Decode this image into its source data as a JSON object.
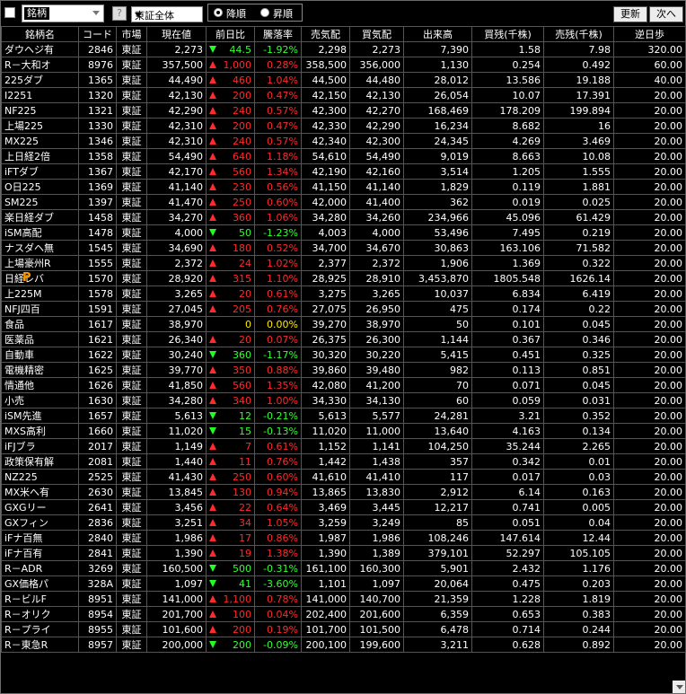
{
  "toolbar": {
    "name_label": "銘柄",
    "help_label": "?",
    "market_selected": "東証全体",
    "sort_desc": "降順",
    "sort_asc": "昇順",
    "update_label": "更新",
    "next_label": "次へ"
  },
  "columns": [
    "銘柄名",
    "コード",
    "市場",
    "現在値",
    "前日比",
    "騰落率",
    "売気配",
    "買気配",
    "出来高",
    "買残(千株)",
    "売残(千株)",
    "逆日歩"
  ],
  "rows": [
    {
      "name": "ダウヘジ有",
      "code": "2846",
      "market": "東証",
      "price": "2,273",
      "dir": "down",
      "change": "44.5",
      "rate": "-1.92%",
      "ask": "2,298",
      "bid": "2,273",
      "volume": "7,390",
      "buy_rem": "1.58",
      "sell_rem": "7.98",
      "reverse": "320.00"
    },
    {
      "name": "R－大和オ",
      "code": "8976",
      "market": "東証",
      "price": "357,500",
      "dir": "up",
      "change": "1,000",
      "rate": "0.28%",
      "ask": "358,500",
      "bid": "356,000",
      "volume": "1,130",
      "buy_rem": "0.254",
      "sell_rem": "0.492",
      "reverse": "60.00"
    },
    {
      "name": "225ダブ",
      "code": "1365",
      "market": "東証",
      "price": "44,490",
      "dir": "up",
      "change": "460",
      "rate": "1.04%",
      "ask": "44,500",
      "bid": "44,480",
      "volume": "28,012",
      "buy_rem": "13.586",
      "sell_rem": "19.188",
      "reverse": "40.00"
    },
    {
      "name": "I2251",
      "code": "1320",
      "market": "東証",
      "price": "42,130",
      "dir": "up",
      "change": "200",
      "rate": "0.47%",
      "ask": "42,150",
      "bid": "42,130",
      "volume": "26,054",
      "buy_rem": "10.07",
      "sell_rem": "17.391",
      "reverse": "20.00"
    },
    {
      "name": "NF225",
      "code": "1321",
      "market": "東証",
      "price": "42,290",
      "dir": "up",
      "change": "240",
      "rate": "0.57%",
      "ask": "42,300",
      "bid": "42,270",
      "volume": "168,469",
      "buy_rem": "178.209",
      "sell_rem": "199.894",
      "reverse": "20.00"
    },
    {
      "name": "上場225",
      "code": "1330",
      "market": "東証",
      "price": "42,310",
      "dir": "up",
      "change": "200",
      "rate": "0.47%",
      "ask": "42,330",
      "bid": "42,290",
      "volume": "16,234",
      "buy_rem": "8.682",
      "sell_rem": "16",
      "reverse": "20.00"
    },
    {
      "name": "MX225",
      "code": "1346",
      "market": "東証",
      "price": "42,310",
      "dir": "up",
      "change": "240",
      "rate": "0.57%",
      "ask": "42,340",
      "bid": "42,300",
      "volume": "24,345",
      "buy_rem": "4.269",
      "sell_rem": "3.469",
      "reverse": "20.00"
    },
    {
      "name": "上日経2倍",
      "code": "1358",
      "market": "東証",
      "price": "54,490",
      "dir": "up",
      "change": "640",
      "rate": "1.18%",
      "ask": "54,610",
      "bid": "54,490",
      "volume": "9,019",
      "buy_rem": "8.663",
      "sell_rem": "10.08",
      "reverse": "20.00"
    },
    {
      "name": "iFTダブ",
      "code": "1367",
      "market": "東証",
      "price": "42,170",
      "dir": "up",
      "change": "560",
      "rate": "1.34%",
      "ask": "42,190",
      "bid": "42,160",
      "volume": "3,514",
      "buy_rem": "1.205",
      "sell_rem": "1.555",
      "reverse": "20.00"
    },
    {
      "name": "O日225",
      "code": "1369",
      "market": "東証",
      "price": "41,140",
      "dir": "up",
      "change": "230",
      "rate": "0.56%",
      "ask": "41,150",
      "bid": "41,140",
      "volume": "1,829",
      "buy_rem": "0.119",
      "sell_rem": "1.881",
      "reverse": "20.00"
    },
    {
      "name": "SM225",
      "code": "1397",
      "market": "東証",
      "price": "41,470",
      "dir": "up",
      "change": "250",
      "rate": "0.60%",
      "ask": "42,000",
      "bid": "41,400",
      "volume": "362",
      "buy_rem": "0.019",
      "sell_rem": "0.025",
      "reverse": "20.00"
    },
    {
      "name": "楽日経ダブ",
      "code": "1458",
      "market": "東証",
      "price": "34,270",
      "dir": "up",
      "change": "360",
      "rate": "1.06%",
      "ask": "34,280",
      "bid": "34,260",
      "volume": "234,966",
      "buy_rem": "45.096",
      "sell_rem": "61.429",
      "reverse": "20.00"
    },
    {
      "name": "iSM高配",
      "code": "1478",
      "market": "東証",
      "price": "4,000",
      "dir": "down",
      "change": "50",
      "rate": "-1.23%",
      "ask": "4,003",
      "bid": "4,000",
      "volume": "53,496",
      "buy_rem": "7.495",
      "sell_rem": "0.219",
      "reverse": "20.00"
    },
    {
      "name": "ナスダヘ無",
      "code": "1545",
      "market": "東証",
      "price": "34,690",
      "dir": "up",
      "change": "180",
      "rate": "0.52%",
      "ask": "34,700",
      "bid": "34,670",
      "volume": "30,863",
      "buy_rem": "163.106",
      "sell_rem": "71.582",
      "reverse": "20.00"
    },
    {
      "name": "上場豪州R",
      "code": "1555",
      "market": "東証",
      "price": "2,372",
      "dir": "up",
      "change": "24",
      "rate": "1.02%",
      "ask": "2,377",
      "bid": "2,372",
      "volume": "1,906",
      "buy_rem": "1.369",
      "sell_rem": "0.322",
      "reverse": "20.00"
    },
    {
      "name": "日経レバ",
      "code": "1570",
      "market": "東証",
      "price": "28,920",
      "dir": "up",
      "change": "315",
      "rate": "1.10%",
      "ask": "28,925",
      "bid": "28,910",
      "volume": "3,453,870",
      "buy_rem": "1805.548",
      "sell_rem": "1626.14",
      "reverse": "20.00",
      "badge": "P"
    },
    {
      "name": "上225M",
      "code": "1578",
      "market": "東証",
      "price": "3,265",
      "dir": "up",
      "change": "20",
      "rate": "0.61%",
      "ask": "3,275",
      "bid": "3,265",
      "volume": "10,037",
      "buy_rem": "6.834",
      "sell_rem": "6.419",
      "reverse": "20.00"
    },
    {
      "name": "NFJ四百",
      "code": "1591",
      "market": "東証",
      "price": "27,045",
      "dir": "up",
      "change": "205",
      "rate": "0.76%",
      "ask": "27,075",
      "bid": "26,950",
      "volume": "475",
      "buy_rem": "0.174",
      "sell_rem": "0.22",
      "reverse": "20.00"
    },
    {
      "name": "食品",
      "code": "1617",
      "market": "東証",
      "price": "38,970",
      "dir": "flat",
      "change": "0",
      "rate": "0.00%",
      "ask": "39,270",
      "bid": "38,970",
      "volume": "50",
      "buy_rem": "0.101",
      "sell_rem": "0.045",
      "reverse": "20.00"
    },
    {
      "name": "医薬品",
      "code": "1621",
      "market": "東証",
      "price": "26,340",
      "dir": "up",
      "change": "20",
      "rate": "0.07%",
      "ask": "26,375",
      "bid": "26,300",
      "volume": "1,144",
      "buy_rem": "0.367",
      "sell_rem": "0.346",
      "reverse": "20.00"
    },
    {
      "name": "自動車",
      "code": "1622",
      "market": "東証",
      "price": "30,240",
      "dir": "down",
      "change": "360",
      "rate": "-1.17%",
      "ask": "30,320",
      "bid": "30,220",
      "volume": "5,415",
      "buy_rem": "0.451",
      "sell_rem": "0.325",
      "reverse": "20.00"
    },
    {
      "name": "電機精密",
      "code": "1625",
      "market": "東証",
      "price": "39,770",
      "dir": "up",
      "change": "350",
      "rate": "0.88%",
      "ask": "39,860",
      "bid": "39,480",
      "volume": "982",
      "buy_rem": "0.113",
      "sell_rem": "0.851",
      "reverse": "20.00"
    },
    {
      "name": "情通他",
      "code": "1626",
      "market": "東証",
      "price": "41,850",
      "dir": "up",
      "change": "560",
      "rate": "1.35%",
      "ask": "42,080",
      "bid": "41,200",
      "volume": "70",
      "buy_rem": "0.071",
      "sell_rem": "0.045",
      "reverse": "20.00"
    },
    {
      "name": "小売",
      "code": "1630",
      "market": "東証",
      "price": "34,280",
      "dir": "up",
      "change": "340",
      "rate": "1.00%",
      "ask": "34,330",
      "bid": "34,130",
      "volume": "60",
      "buy_rem": "0.059",
      "sell_rem": "0.031",
      "reverse": "20.00"
    },
    {
      "name": "iSM先進",
      "code": "1657",
      "market": "東証",
      "price": "5,613",
      "dir": "down",
      "change": "12",
      "rate": "-0.21%",
      "ask": "5,613",
      "bid": "5,577",
      "volume": "24,281",
      "buy_rem": "3.21",
      "sell_rem": "0.352",
      "reverse": "20.00"
    },
    {
      "name": "MXS高利",
      "code": "1660",
      "market": "東証",
      "price": "11,020",
      "dir": "down",
      "change": "15",
      "rate": "-0.13%",
      "ask": "11,020",
      "bid": "11,000",
      "volume": "13,640",
      "buy_rem": "4.163",
      "sell_rem": "0.134",
      "reverse": "20.00"
    },
    {
      "name": "iFJブラ",
      "code": "2017",
      "market": "東証",
      "price": "1,149",
      "dir": "up",
      "change": "7",
      "rate": "0.61%",
      "ask": "1,152",
      "bid": "1,141",
      "volume": "104,250",
      "buy_rem": "35.244",
      "sell_rem": "2.265",
      "reverse": "20.00"
    },
    {
      "name": "政策保有解",
      "code": "2081",
      "market": "東証",
      "price": "1,440",
      "dir": "up",
      "change": "11",
      "rate": "0.76%",
      "ask": "1,442",
      "bid": "1,438",
      "volume": "357",
      "buy_rem": "0.342",
      "sell_rem": "0.01",
      "reverse": "20.00"
    },
    {
      "name": "NZ225",
      "code": "2525",
      "market": "東証",
      "price": "41,430",
      "dir": "up",
      "change": "250",
      "rate": "0.60%",
      "ask": "41,610",
      "bid": "41,410",
      "volume": "117",
      "buy_rem": "0.017",
      "sell_rem": "0.03",
      "reverse": "20.00"
    },
    {
      "name": "MX米へ有",
      "code": "2630",
      "market": "東証",
      "price": "13,845",
      "dir": "up",
      "change": "130",
      "rate": "0.94%",
      "ask": "13,865",
      "bid": "13,830",
      "volume": "2,912",
      "buy_rem": "6.14",
      "sell_rem": "0.163",
      "reverse": "20.00"
    },
    {
      "name": "GXGリー",
      "code": "2641",
      "market": "東証",
      "price": "3,456",
      "dir": "up",
      "change": "22",
      "rate": "0.64%",
      "ask": "3,469",
      "bid": "3,445",
      "volume": "12,217",
      "buy_rem": "0.741",
      "sell_rem": "0.005",
      "reverse": "20.00"
    },
    {
      "name": "GXフィン",
      "code": "2836",
      "market": "東証",
      "price": "3,251",
      "dir": "up",
      "change": "34",
      "rate": "1.05%",
      "ask": "3,259",
      "bid": "3,249",
      "volume": "85",
      "buy_rem": "0.051",
      "sell_rem": "0.04",
      "reverse": "20.00"
    },
    {
      "name": "iFナ百無",
      "code": "2840",
      "market": "東証",
      "price": "1,986",
      "dir": "up",
      "change": "17",
      "rate": "0.86%",
      "ask": "1,987",
      "bid": "1,986",
      "volume": "108,246",
      "buy_rem": "147.614",
      "sell_rem": "12.44",
      "reverse": "20.00"
    },
    {
      "name": "iFナ百有",
      "code": "2841",
      "market": "東証",
      "price": "1,390",
      "dir": "up",
      "change": "19",
      "rate": "1.38%",
      "ask": "1,390",
      "bid": "1,389",
      "volume": "379,101",
      "buy_rem": "52.297",
      "sell_rem": "105.105",
      "reverse": "20.00"
    },
    {
      "name": "R－ADR",
      "code": "3269",
      "market": "東証",
      "price": "160,500",
      "dir": "down",
      "change": "500",
      "rate": "-0.31%",
      "ask": "161,100",
      "bid": "160,300",
      "volume": "5,901",
      "buy_rem": "2.432",
      "sell_rem": "1.176",
      "reverse": "20.00"
    },
    {
      "name": "GX価格パ",
      "code": "328A",
      "market": "東証",
      "price": "1,097",
      "dir": "down",
      "change": "41",
      "rate": "-3.60%",
      "ask": "1,101",
      "bid": "1,097",
      "volume": "20,064",
      "buy_rem": "0.475",
      "sell_rem": "0.203",
      "reverse": "20.00"
    },
    {
      "name": "R－ビルF",
      "code": "8951",
      "market": "東証",
      "price": "141,000",
      "dir": "up",
      "change": "1,100",
      "rate": "0.78%",
      "ask": "141,000",
      "bid": "140,700",
      "volume": "21,359",
      "buy_rem": "1.228",
      "sell_rem": "1.819",
      "reverse": "20.00"
    },
    {
      "name": "R－オリク",
      "code": "8954",
      "market": "東証",
      "price": "201,700",
      "dir": "up",
      "change": "100",
      "rate": "0.04%",
      "ask": "202,400",
      "bid": "201,600",
      "volume": "6,359",
      "buy_rem": "0.653",
      "sell_rem": "0.383",
      "reverse": "20.00"
    },
    {
      "name": "R－プライ",
      "code": "8955",
      "market": "東証",
      "price": "101,600",
      "dir": "up",
      "change": "200",
      "rate": "0.19%",
      "ask": "101,700",
      "bid": "101,500",
      "volume": "6,478",
      "buy_rem": "0.714",
      "sell_rem": "0.244",
      "reverse": "20.00"
    },
    {
      "name": "R－東急R",
      "code": "8957",
      "market": "東証",
      "price": "200,000",
      "dir": "down",
      "change": "200",
      "rate": "-0.09%",
      "ask": "200,100",
      "bid": "199,600",
      "volume": "3,211",
      "buy_rem": "0.628",
      "sell_rem": "0.892",
      "reverse": "20.00"
    }
  ],
  "colors": {
    "up": "#ff2a2a",
    "down": "#33ff33",
    "flat": "#ffee00",
    "background": "#000000",
    "grid": "#555555"
  },
  "icons": {
    "badge": "p-badge-icon",
    "rise": "triangle-up-icon",
    "fall": "triangle-down-icon"
  }
}
